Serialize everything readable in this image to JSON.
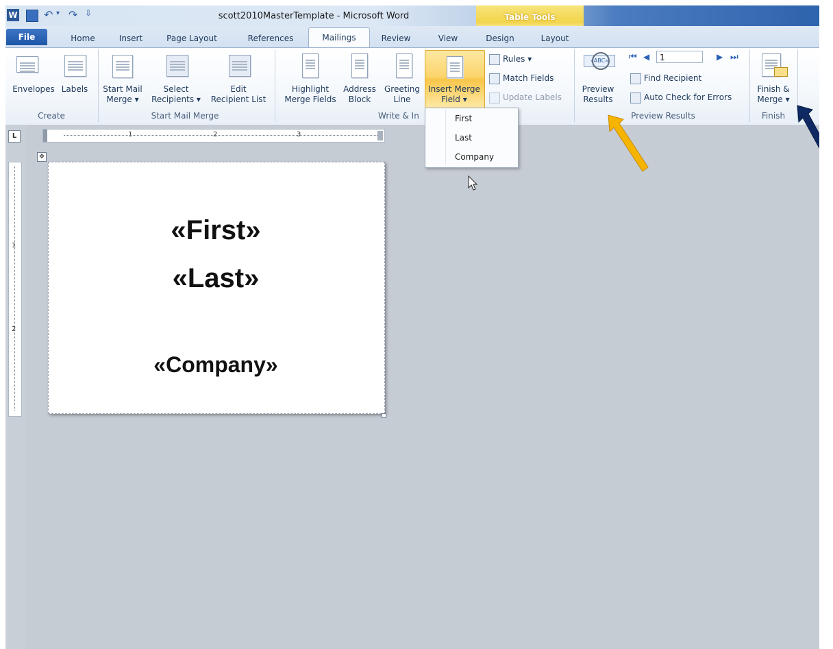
{
  "window": {
    "title": "scott2010MasterTemplate - Microsoft Word",
    "contextual_tab_group": "Table Tools"
  },
  "tabs": [
    "File",
    "Home",
    "Insert",
    "Page Layout",
    "References",
    "Mailings",
    "Review",
    "View",
    "Design",
    "Layout"
  ],
  "active_tab": "Mailings",
  "ribbon": {
    "create": {
      "label": "Create",
      "envelopes": "Envelopes",
      "labels": "Labels"
    },
    "start_mail_merge": {
      "label": "Start Mail Merge",
      "start_line1": "Start Mail",
      "start_line2": "Merge ▾",
      "select_line1": "Select",
      "select_line2": "Recipients ▾",
      "edit_line1": "Edit",
      "edit_line2": "Recipient List"
    },
    "write_insert": {
      "label": "Write & In",
      "highlight_line1": "Highlight",
      "highlight_line2": "Merge Fields",
      "address_line1": "Address",
      "address_line2": "Block",
      "greeting_line1": "Greeting",
      "greeting_line2": "Line",
      "insert_line1": "Insert Merge",
      "insert_line2": "Field ▾",
      "rules": "Rules ▾",
      "match_fields": "Match Fields",
      "update_labels": "Update Labels"
    },
    "preview_results": {
      "label": "Preview Results",
      "preview_line1": "Preview",
      "preview_line2": "Results",
      "record_value": "1",
      "find_recipient": "Find Recipient",
      "auto_check": "Auto Check for Errors"
    },
    "finish": {
      "label": "Finish",
      "finish_line1": "Finish &",
      "finish_line2": "Merge ▾"
    }
  },
  "dropdown": {
    "items": [
      "First",
      "Last",
      "Company"
    ]
  },
  "document": {
    "field_first": "«First»",
    "field_last": "«Last»",
    "field_company": "«Company»"
  },
  "ruler": {
    "h_numbers": [
      "1",
      "2",
      "3"
    ],
    "v_numbers": [
      "1",
      "2"
    ],
    "corner": "L"
  },
  "colors": {
    "arrow_gold": "#f5b400",
    "arrow_navy": "#0f2a63"
  }
}
